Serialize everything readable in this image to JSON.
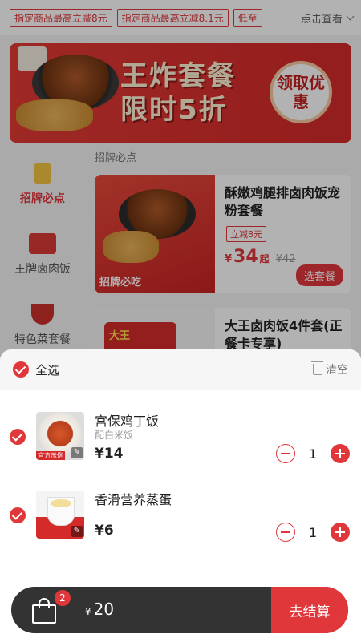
{
  "colors": {
    "accent": "#e0373b",
    "cart_bar": "#333333",
    "overlay": "rgba(0,0,0,0.30)"
  },
  "promo": {
    "tags": [
      "指定商品最高立减8元",
      "指定商品最高立减8.1元",
      "低至"
    ],
    "more_label": "点击查看"
  },
  "banner": {
    "title_line1": "王炸套餐",
    "title_line2": "限时5折",
    "badge_text": "领取优惠"
  },
  "sidebar": {
    "items": [
      {
        "label": "招牌必点",
        "icon": "thumbs-up-icon",
        "active": true
      },
      {
        "label": "王牌卤肉饭",
        "icon": "rice-icon",
        "active": false
      },
      {
        "label": "特色菜套餐",
        "icon": "bowl-icon",
        "active": false
      }
    ]
  },
  "menu": {
    "section_title": "招牌必点",
    "products": [
      {
        "name": "酥嫩鸡腿排卤肉饭宠粉套餐",
        "coupon": "立减8元",
        "currency": "¥",
        "price": "34",
        "price_suffix": "起",
        "original_price": "¥42",
        "action": "选套餐",
        "image_label": "招牌必吃"
      },
      {
        "name": "大王卤肉饭4件套(正餐卡专享)",
        "image_label": "大王"
      }
    ]
  },
  "cart": {
    "select_all_label": "全选",
    "clear_label": "清空",
    "items": [
      {
        "name": "宫保鸡丁饭",
        "sub": "配白米饭",
        "price": "¥14",
        "qty": "1",
        "image_stamp": "官方示例",
        "icon": "kung-pao-chicken-rice-image"
      },
      {
        "name": "香滑营养蒸蛋",
        "sub": "",
        "price": "¥6",
        "qty": "1",
        "icon": "steamed-egg-image"
      }
    ],
    "badge_count": "2",
    "currency": "¥",
    "total": "20",
    "checkout_label": "去结算"
  }
}
